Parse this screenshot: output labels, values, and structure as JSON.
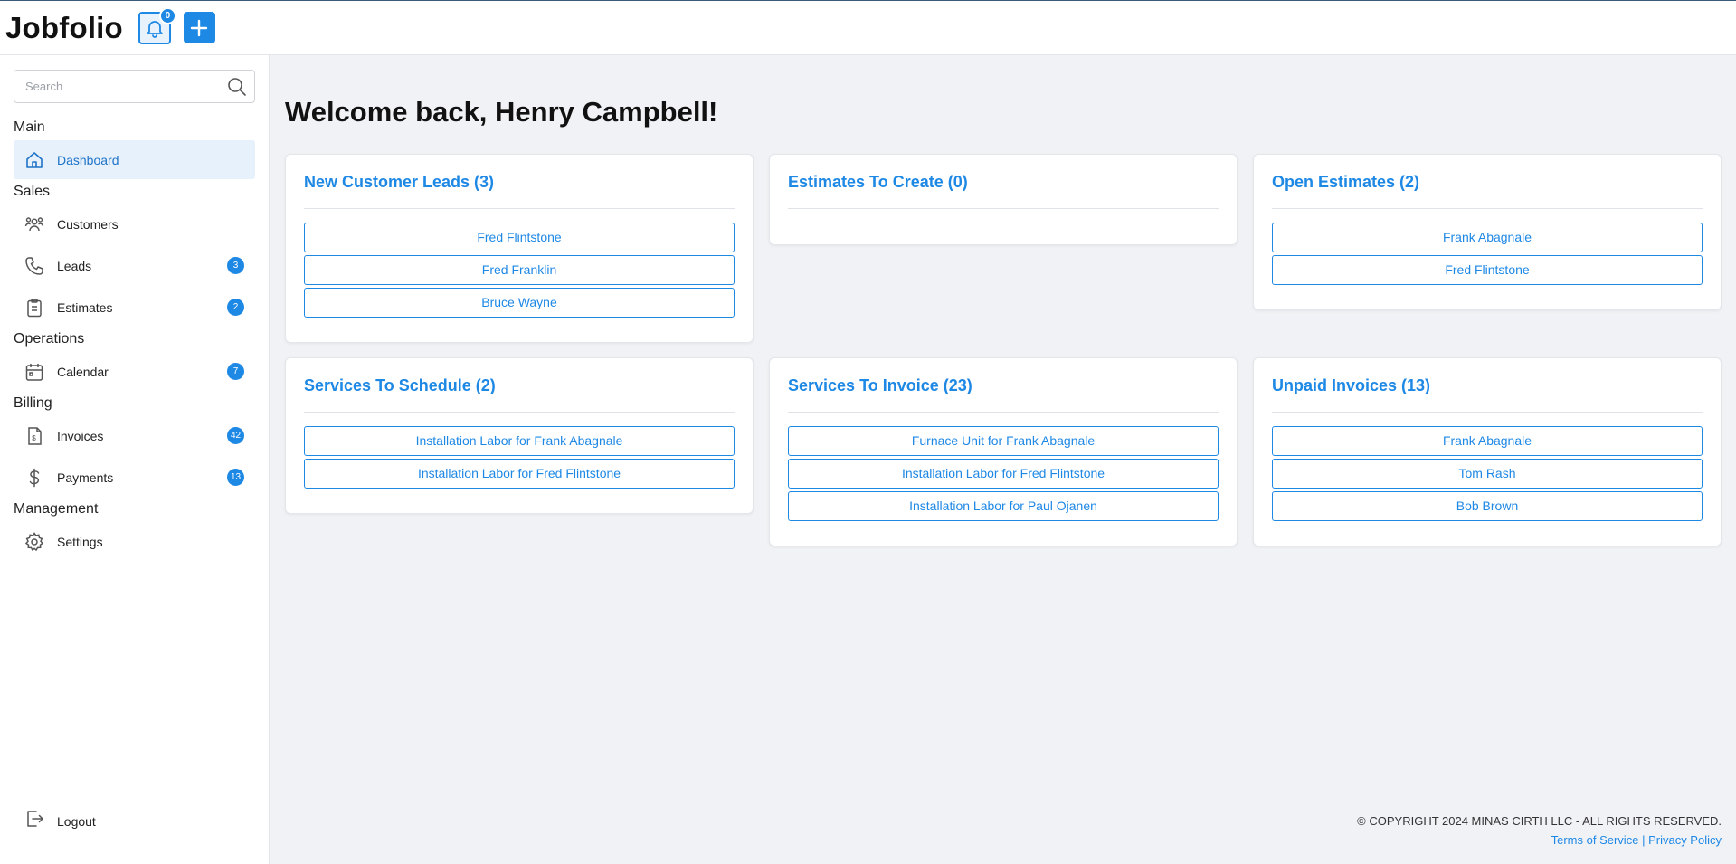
{
  "app": {
    "name": "Jobfolio"
  },
  "header": {
    "notification_count": "0"
  },
  "search": {
    "placeholder": "Search"
  },
  "sidebar": {
    "sections": {
      "main": "Main",
      "sales": "Sales",
      "operations": "Operations",
      "billing": "Billing",
      "management": "Management"
    },
    "items": {
      "dashboard": {
        "label": "Dashboard",
        "icon": "home-icon"
      },
      "customers": {
        "label": "Customers",
        "icon": "users-icon"
      },
      "leads": {
        "label": "Leads",
        "icon": "phone-icon",
        "badge": "3"
      },
      "estimates": {
        "label": "Estimates",
        "icon": "clipboard-icon",
        "badge": "2"
      },
      "calendar": {
        "label": "Calendar",
        "icon": "calendar-icon",
        "badge": "7"
      },
      "invoices": {
        "label": "Invoices",
        "icon": "invoice-icon",
        "badge": "42"
      },
      "payments": {
        "label": "Payments",
        "icon": "dollar-icon",
        "badge": "13"
      },
      "settings": {
        "label": "Settings",
        "icon": "gear-icon"
      }
    },
    "logout": "Logout"
  },
  "main": {
    "welcome": "Welcome back, Henry Campbell!",
    "cards": {
      "new_leads": {
        "title": "New Customer Leads (3)",
        "items": [
          "Fred Flintstone",
          "Fred Franklin",
          "Bruce Wayne"
        ]
      },
      "estimates_to_create": {
        "title": "Estimates To Create (0)",
        "items": []
      },
      "open_estimates": {
        "title": "Open Estimates (2)",
        "items": [
          "Frank Abagnale",
          "Fred Flintstone"
        ]
      },
      "services_to_schedule": {
        "title": "Services To Schedule (2)",
        "items": [
          "Installation Labor for Frank Abagnale",
          "Installation Labor for Fred Flintstone"
        ]
      },
      "services_to_invoice": {
        "title": "Services To Invoice (23)",
        "items": [
          "Furnace Unit for Frank Abagnale",
          "Installation Labor for Fred Flintstone",
          "Installation Labor for Paul Ojanen"
        ]
      },
      "unpaid_invoices": {
        "title": "Unpaid Invoices (13)",
        "items": [
          "Frank Abagnale",
          "Tom Rash",
          "Bob Brown"
        ]
      }
    }
  },
  "footer": {
    "copyright": "© COPYRIGHT 2024 MINAS CIRTH LLC - ALL RIGHTS RESERVED.",
    "terms": "Terms of Service",
    "separator": "|",
    "privacy": "Privacy Policy"
  },
  "colors": {
    "accent": "#1e88e5",
    "active_bg": "#e6f1fb",
    "page_bg": "#f0f2f5"
  }
}
